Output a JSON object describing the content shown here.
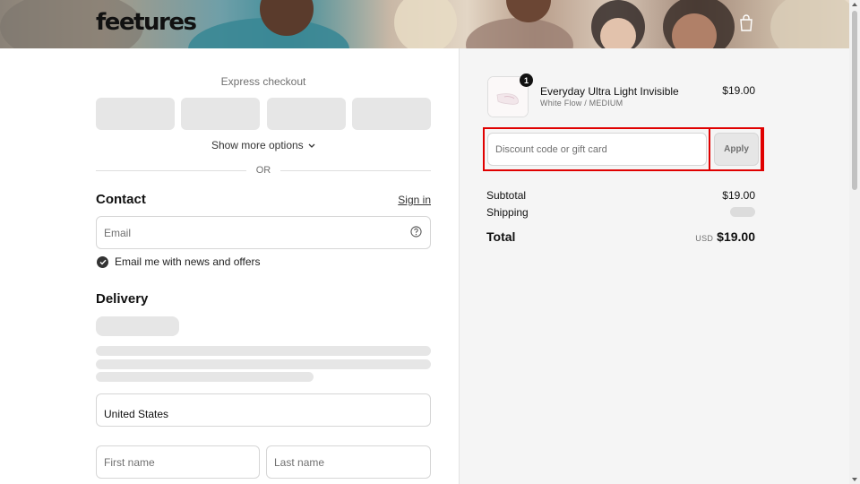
{
  "header": {
    "logo": "feetures",
    "cart_icon": "shopping-bag-icon"
  },
  "express": {
    "title": "Express checkout",
    "button_count": 4,
    "show_more": "Show more options",
    "divider": "OR"
  },
  "contact": {
    "title": "Contact",
    "sign_in": "Sign in",
    "email_placeholder": "Email",
    "newsletter_label": "Email me with news and offers",
    "newsletter_checked": true
  },
  "delivery": {
    "title": "Delivery",
    "country_value": "United States",
    "first_name_placeholder": "First name",
    "last_name_placeholder": "Last name"
  },
  "order": {
    "item": {
      "name": "Everyday Ultra Light Invisible",
      "variant": "White Flow / MEDIUM",
      "price": "$19.00",
      "quantity": "1"
    },
    "discount_placeholder": "Discount code or gift card",
    "apply_label": "Apply",
    "subtotal_label": "Subtotal",
    "subtotal_value": "$19.00",
    "shipping_label": "Shipping",
    "total_label": "Total",
    "total_currency": "USD",
    "total_value": "$19.00"
  },
  "colors": {
    "highlight": "#e00000",
    "skeleton": "#e6e6e6",
    "sidebar_bg": "#f5f5f5"
  }
}
